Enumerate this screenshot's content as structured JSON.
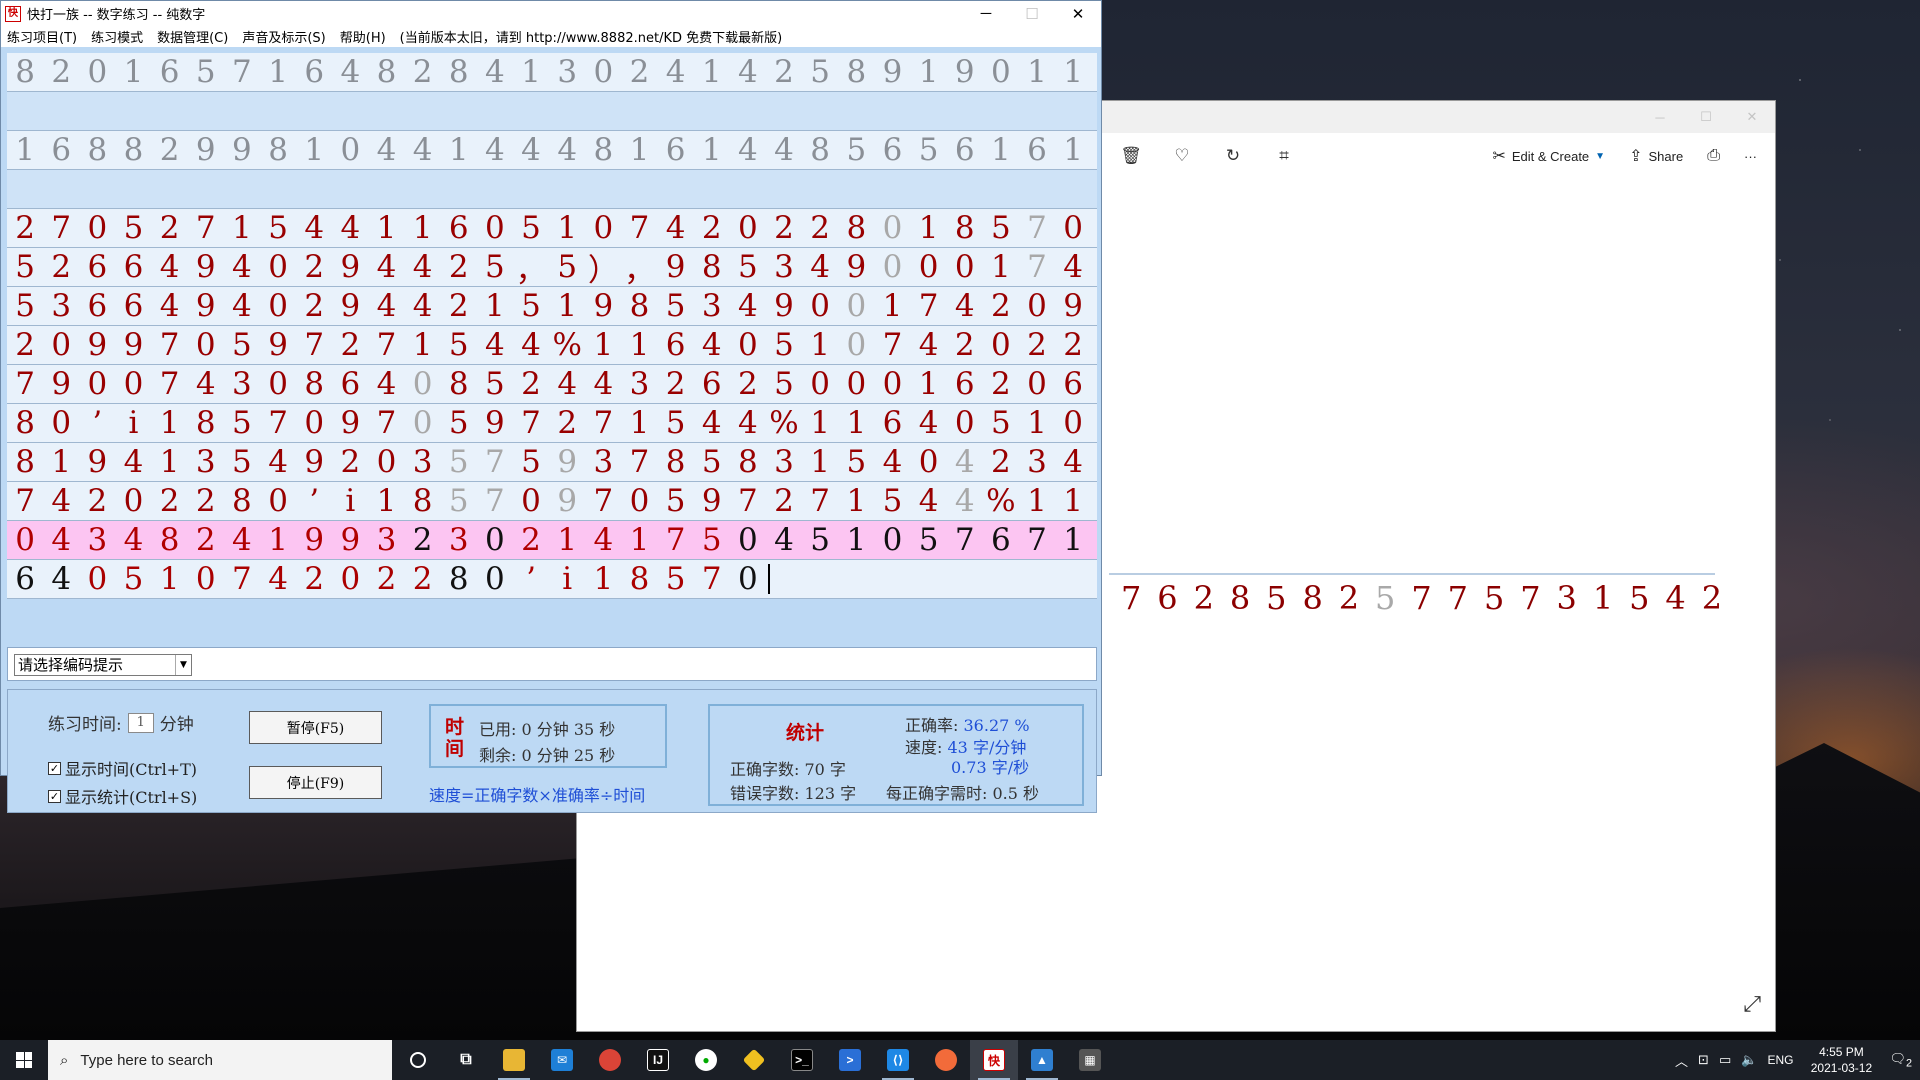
{
  "typing_window": {
    "title": "快打一族 -- 数字练习 -- 纯数字",
    "icon_text": "快",
    "controls": {
      "minimize": "─",
      "maximize": "☐",
      "close": "✕"
    },
    "menu": [
      "练习项目(T)",
      "练习模式",
      "数据管理(C)",
      "声音及标示(S)",
      "帮助(H)",
      "(当前版本太旧，请到 http://www.8882.net/KD 免费下载最新版)"
    ],
    "reference_rows": [
      "82016571648284130241425891901 1",
      "16882998104414448161448565616 1"
    ],
    "ref_row_1": [
      "8",
      "2",
      "0",
      "1",
      "6",
      "5",
      "7",
      "1",
      "6",
      "4",
      "8",
      "2",
      "8",
      "4",
      "1",
      "3",
      "0",
      "2",
      "4",
      "1",
      "4",
      "2",
      "5",
      "8",
      "9",
      "1",
      "9",
      "0",
      "1",
      "1"
    ],
    "ref_row_2": [
      "1",
      "6",
      "8",
      "8",
      "2",
      "9",
      "9",
      "8",
      "1",
      "0",
      "4",
      "4",
      "1",
      "4",
      "4",
      "4",
      "8",
      "1",
      "6",
      "1",
      "4",
      "4",
      "8",
      "5",
      "6",
      "5",
      "6",
      "1",
      "6",
      "1"
    ],
    "typed_rows": [
      {
        "chars": [
          "2",
          "7",
          "0",
          "5",
          "2",
          "7",
          "1",
          "5",
          "4",
          "4",
          "1",
          "1",
          "6",
          "0",
          "5",
          "1",
          "0",
          "7",
          "4",
          "2",
          "0",
          "2",
          "2",
          "8",
          "0",
          "1",
          "8",
          "5",
          "7",
          "0"
        ],
        "gray": [
          24,
          28
        ]
      },
      {
        "chars": [
          "5",
          "2",
          "6",
          "6",
          "4",
          "9",
          "4",
          "0",
          "2",
          "9",
          "4",
          "4",
          "2",
          "5",
          "，",
          "5",
          "）",
          "，",
          "9",
          "8",
          "5",
          "3",
          "4",
          "9",
          "0",
          "0",
          "0",
          "1",
          "7",
          "4"
        ],
        "gray": [
          24,
          28
        ]
      },
      {
        "chars": [
          "5",
          "3",
          "6",
          "6",
          "4",
          "9",
          "4",
          "0",
          "2",
          "9",
          "4",
          "4",
          "2",
          "1",
          "5",
          "1",
          "9",
          "8",
          "5",
          "3",
          "4",
          "9",
          "0",
          "0",
          "1",
          "7",
          "4",
          "2",
          "0",
          "9"
        ],
        "gray": [
          23
        ]
      },
      {
        "chars": [
          "2",
          "0",
          "9",
          "9",
          "7",
          "0",
          "5",
          "9",
          "7",
          "2",
          "7",
          "1",
          "5",
          "4",
          "4",
          "%",
          "1",
          "1",
          "6",
          "4",
          "0",
          "5",
          "1",
          "0",
          "7",
          "4",
          "2",
          "0",
          "2",
          "2"
        ],
        "gray": [
          23
        ]
      },
      {
        "chars": [
          "7",
          "9",
          "0",
          "0",
          "7",
          "4",
          "3",
          "0",
          "8",
          "6",
          "4",
          "0",
          "8",
          "5",
          "2",
          "4",
          "4",
          "3",
          "2",
          "6",
          "2",
          "5",
          "0",
          "0",
          "0",
          "1",
          "6",
          "2",
          "0",
          "6"
        ],
        "gray": [
          11
        ]
      },
      {
        "chars": [
          "8",
          "0",
          "’",
          "i",
          "1",
          "8",
          "5",
          "7",
          "0",
          "9",
          "7",
          "0",
          "5",
          "9",
          "7",
          "2",
          "7",
          "1",
          "5",
          "4",
          "4",
          "%",
          "1",
          "1",
          "6",
          "4",
          "0",
          "5",
          "1",
          "0"
        ],
        "gray": [
          11
        ]
      },
      {
        "chars": [
          "8",
          "1",
          "9",
          "4",
          "1",
          "3",
          "5",
          "4",
          "9",
          "2",
          "0",
          "3",
          "5",
          "7",
          "5",
          "9",
          "3",
          "7",
          "8",
          "5",
          "8",
          "3",
          "1",
          "5",
          "4",
          "0",
          "4",
          "2",
          "3",
          "4"
        ],
        "gray": [
          12,
          13,
          15,
          26
        ]
      },
      {
        "chars": [
          "7",
          "4",
          "2",
          "0",
          "2",
          "2",
          "8",
          "0",
          "’",
          "i",
          "1",
          "8",
          "5",
          "7",
          "0",
          "9",
          "7",
          "0",
          "5",
          "9",
          "7",
          "2",
          "7",
          "1",
          "5",
          "4",
          "4",
          "%",
          "1",
          "1"
        ],
        "gray": [
          12,
          13,
          15,
          26
        ]
      }
    ],
    "pink_row": {
      "chars": [
        "0",
        "4",
        "3",
        "4",
        "8",
        "2",
        "4",
        "1",
        "9",
        "9",
        "3",
        "2",
        "3",
        "0",
        "2",
        "1",
        "4",
        "1",
        "7",
        "5",
        "0",
        "4",
        "5",
        "1",
        "0",
        "5",
        "7",
        "6",
        "7",
        "1"
      ],
      "dark": [
        11,
        13,
        20,
        21,
        22,
        23,
        24,
        25,
        26,
        27,
        28,
        29
      ]
    },
    "current_row": {
      "chars": [
        "6",
        "4",
        "0",
        "5",
        "1",
        "0",
        "7",
        "4",
        "2",
        "0",
        "2",
        "2",
        "8",
        "0",
        "’",
        "i",
        "1",
        "8",
        "5",
        "7",
        "0"
      ],
      "dark": [
        0,
        1,
        12,
        13,
        20
      ]
    },
    "hint_select": {
      "value": "请选择编码提示"
    },
    "settings": {
      "practice_time_label": "练习时间:",
      "practice_time_value": "1",
      "practice_time_unit": "分钟",
      "show_time": "显示时间(Ctrl+T)",
      "show_stats": "显示统计(Ctrl+S)",
      "pause_button": "暂停(F5)",
      "stop_button": "停止(F9)"
    },
    "time": {
      "label": "时间",
      "used": "已用: 0 分钟 35 秒",
      "remaining": "剩余: 0 分钟 25 秒",
      "formula": "速度=正确字数×准确率÷时间"
    },
    "stats": {
      "title": "统计",
      "accuracy_label": "正确率:",
      "accuracy_value": "36.27 %",
      "speed_label": "速度:",
      "speed_value": "43 字/分钟",
      "speed_value2": "0.73 字/秒",
      "correct": "正确字数: 70 字",
      "wrong": "错误字数: 123 字",
      "per_char": "每正确字需时: 0.5 秒"
    }
  },
  "photos_window": {
    "controls": {
      "minimize": "─",
      "maximize": "☐",
      "close": "✕"
    },
    "toolbar": {
      "edit_create": "Edit & Create",
      "share": "Share",
      "more": "···"
    },
    "image_digits": [
      "7",
      "6",
      "2",
      "8",
      "5",
      "8",
      "2",
      "5",
      "7",
      "7",
      "5",
      "7",
      "3",
      "1",
      "5",
      "4",
      "2"
    ],
    "image_digits_gray": [
      7
    ]
  },
  "taskbar": {
    "search_placeholder": "Type here to search",
    "language": "ENG",
    "time": "4:55 PM",
    "date": "2021-03-12",
    "notification_count": "2"
  },
  "colors": {
    "error_red": "#990000",
    "pink_row": "#fcc5f2",
    "panel_blue": "#bdd9f4",
    "formula_blue": "#1f4fd6"
  }
}
